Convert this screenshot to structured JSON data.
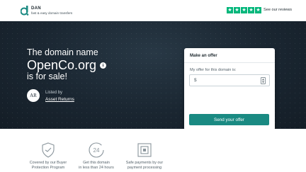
{
  "header": {
    "brand": "DAN",
    "tagline": "fast & easy domain transfers",
    "rating_stars": 5,
    "reviews_link": "See our reviews",
    "accent_color": "#00b67a"
  },
  "hero": {
    "headline_line1": "The domain name",
    "domain": "OpenCo.org",
    "headline_line3": "is for sale!",
    "info_icon": "i",
    "seller": {
      "avatar_text": "AR",
      "listed_by_label": "Listed by",
      "name": "Asset Returns"
    }
  },
  "offer": {
    "title": "Make an offer",
    "field_label": "My offer for this domain is:",
    "currency_symbol": "$",
    "value": "",
    "placeholder": "",
    "button_label": "Send your offer",
    "button_color": "#1a8a82"
  },
  "features": [
    {
      "icon": "shield-handshake-icon",
      "text_line1": "Covered by our Buyer",
      "text_line2": "Protection Program"
    },
    {
      "icon": "24-hours-clock-icon",
      "icon_label": "24",
      "text_line1": "Get this domain",
      "text_line2": "in less than 24 hours"
    },
    {
      "icon": "secure-payment-icon",
      "text_line1": "Safe payments by our",
      "text_line2": "payment processing"
    }
  ]
}
